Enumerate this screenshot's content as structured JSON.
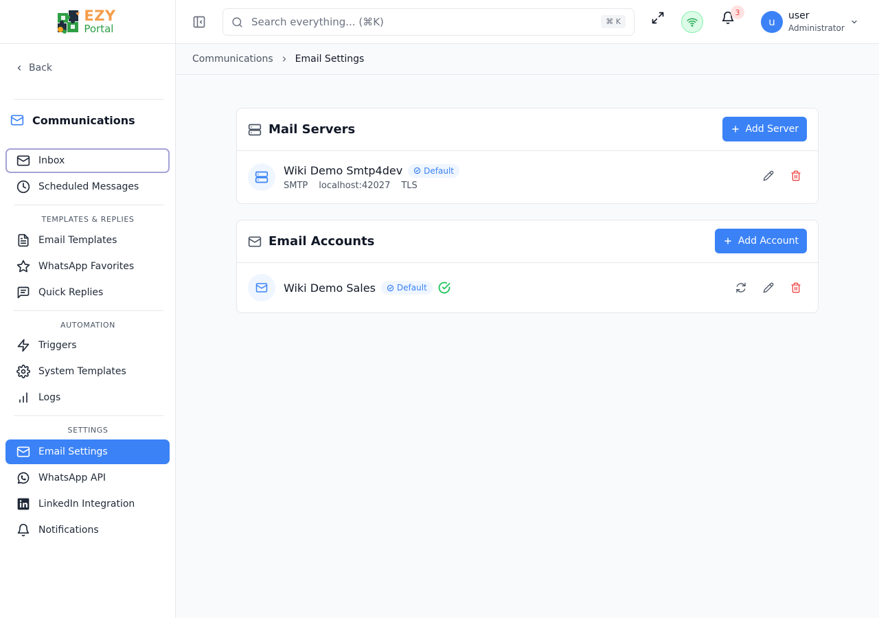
{
  "logo": {
    "top": "EZY",
    "bottom": "Portal"
  },
  "sidebar": {
    "back_label": "Back",
    "section_title": "Communications",
    "items": [
      {
        "label": "Inbox",
        "icon": "mail-icon"
      },
      {
        "label": "Scheduled Messages",
        "icon": "clock-icon"
      }
    ],
    "group_templates": "TEMPLATES & REPLIES",
    "templates_items": [
      {
        "label": "Email Templates",
        "icon": "file-text-icon"
      },
      {
        "label": "WhatsApp Favorites",
        "icon": "star-icon"
      },
      {
        "label": "Quick Replies",
        "icon": "message-square-icon"
      }
    ],
    "group_automation": "AUTOMATION",
    "automation_items": [
      {
        "label": "Triggers",
        "icon": "zap-icon"
      },
      {
        "label": "System Templates",
        "icon": "gear-icon"
      },
      {
        "label": "Logs",
        "icon": "bar-chart-icon"
      }
    ],
    "group_settings": "SETTINGS",
    "settings_items": [
      {
        "label": "Email Settings",
        "icon": "mail-icon",
        "active": true
      },
      {
        "label": "WhatsApp API",
        "icon": "whatsapp-icon"
      },
      {
        "label": "LinkedIn Integration",
        "icon": "linkedin-icon"
      },
      {
        "label": "Notifications",
        "icon": "bell-icon"
      }
    ]
  },
  "header": {
    "search_placeholder": "Search everything... (⌘K)",
    "shortcut": "⌘ K",
    "notification_count": "3",
    "user_initial": "u",
    "user_name": "user",
    "user_role": "Administrator"
  },
  "breadcrumb": {
    "parent": "Communications",
    "current": "Email Settings"
  },
  "mail_servers": {
    "title": "Mail Servers",
    "add_label": "Add Server",
    "items": [
      {
        "name": "Wiki Demo Smtp4dev",
        "badge": "Default",
        "protocol": "SMTP",
        "host": "localhost:42027",
        "security": "TLS"
      }
    ]
  },
  "email_accounts": {
    "title": "Email Accounts",
    "add_label": "Add Account",
    "items": [
      {
        "name": "Wiki Demo Sales",
        "badge": "Default",
        "status": "connected"
      }
    ]
  },
  "colors": {
    "primary": "#3b82f6",
    "danger": "#ef4444",
    "success": "#22c55e",
    "logo_orange": "#f59e4c",
    "logo_green": "#2e9f45"
  }
}
